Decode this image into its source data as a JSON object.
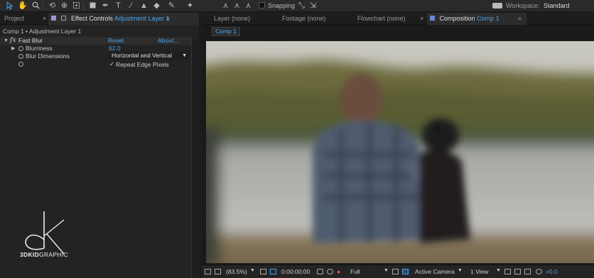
{
  "toolbar": {
    "tools": [
      "selection-tool",
      "hand-tool",
      "zoom-tool",
      "rotate-tool",
      "camera-orbit-tool",
      "pan-behind-tool",
      "rectangle-tool",
      "pen-tool",
      "type-tool",
      "brush-tool",
      "clone-stamp-tool",
      "eraser-tool",
      "roto-brush-tool",
      "puppet-pin-tool"
    ],
    "snapping_label": "Snapping",
    "workspace_label": "Workspace:",
    "workspace_value": "Standard"
  },
  "left_panel": {
    "tabs": {
      "project": "Project",
      "effect_controls_prefix": "Effect Controls",
      "effect_controls_layer": "Adjustment Layer 1"
    },
    "breadcrumb": "Comp 1 • Adjustment Layer 1",
    "effect": {
      "fx_label": "fx",
      "name": "Fast Blur",
      "reset": "Reset",
      "about": "About...",
      "blurriness_label": "Blurriness",
      "blurriness_value": "62.0",
      "dimensions_label": "Blur Dimensions",
      "dimensions_value": "Horizontal and Vertical",
      "repeat_label": "Repeat Edge Pixels",
      "repeat_checked": "✓"
    }
  },
  "right_panel": {
    "tabs": {
      "layer": "Layer (none)",
      "footage": "Footage (none)",
      "flowchart": "Flowchart (none)",
      "composition_prefix": "Composition",
      "composition_name": "Comp 1"
    },
    "comp_tag": "Comp 1",
    "viewer_bar": {
      "zoom": "(83.5%)",
      "timecode": "0:00:00:00",
      "resolution": "Full",
      "camera": "Active Camera",
      "views": "1 View",
      "exposure": "+0.0"
    }
  },
  "logo": {
    "bold": "3DKID",
    "thin": "GRAPHIC"
  },
  "colors": {
    "accent_blue": "#4da6ef",
    "panel_bg": "#232323"
  }
}
